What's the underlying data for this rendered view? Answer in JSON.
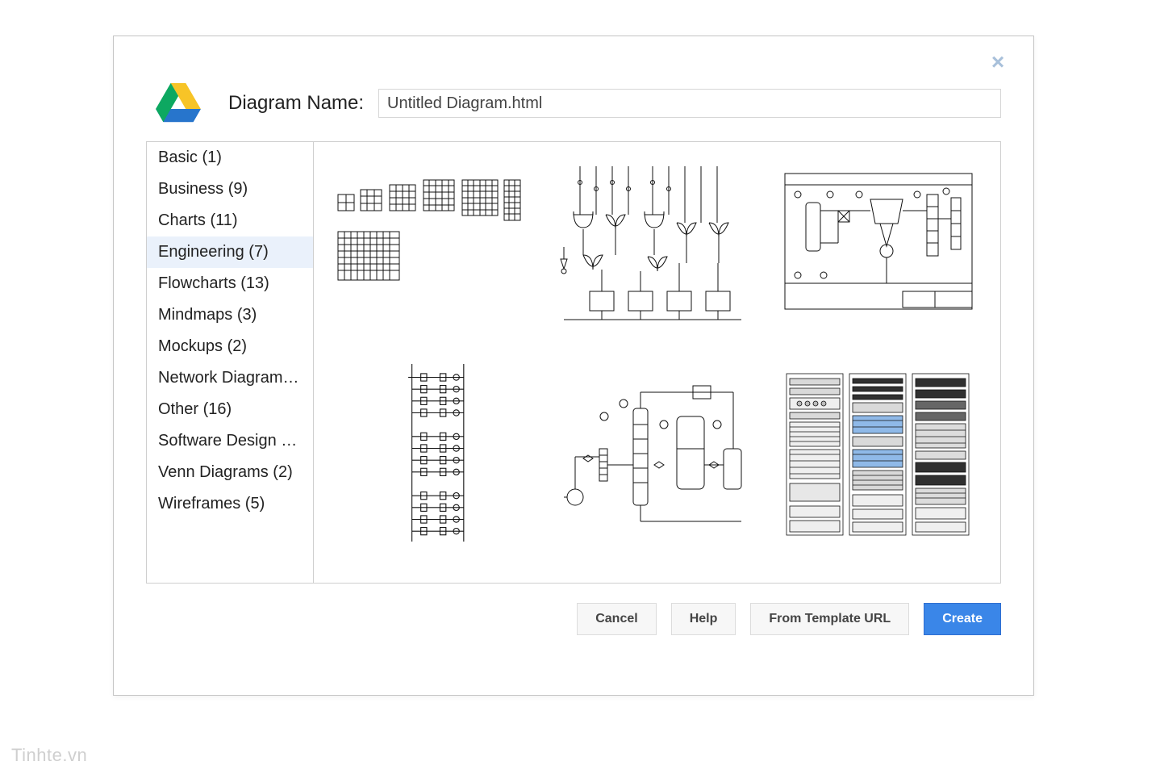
{
  "header": {
    "label": "Diagram Name:",
    "filename": "Untitled Diagram.html"
  },
  "sidebar": {
    "items": [
      {
        "label": "Basic (1)",
        "selected": false
      },
      {
        "label": "Business (9)",
        "selected": false
      },
      {
        "label": "Charts (11)",
        "selected": false
      },
      {
        "label": "Engineering (7)",
        "selected": true
      },
      {
        "label": "Flowcharts (13)",
        "selected": false
      },
      {
        "label": "Mindmaps (3)",
        "selected": false
      },
      {
        "label": "Mockups (2)",
        "selected": false
      },
      {
        "label": "Network Diagram…",
        "selected": false
      },
      {
        "label": "Other (16)",
        "selected": false
      },
      {
        "label": "Software Design (…",
        "selected": false
      },
      {
        "label": "Venn Diagrams (2)",
        "selected": false
      },
      {
        "label": "Wireframes (5)",
        "selected": false
      }
    ]
  },
  "gallery": {
    "templates": [
      {
        "name": "breadboard-grids"
      },
      {
        "name": "logic-circuit"
      },
      {
        "name": "process-flow-diagram"
      },
      {
        "name": "ladder-diagram"
      },
      {
        "name": "piping-instrumentation"
      },
      {
        "name": "server-racks"
      }
    ]
  },
  "footer": {
    "cancel": "Cancel",
    "help": "Help",
    "from_url": "From Template URL",
    "create": "Create"
  },
  "watermark": "Tinhte.vn",
  "colors": {
    "primary": "#3a86e8",
    "selected_bg": "#eaf1fb",
    "border": "#cfcfcf"
  }
}
